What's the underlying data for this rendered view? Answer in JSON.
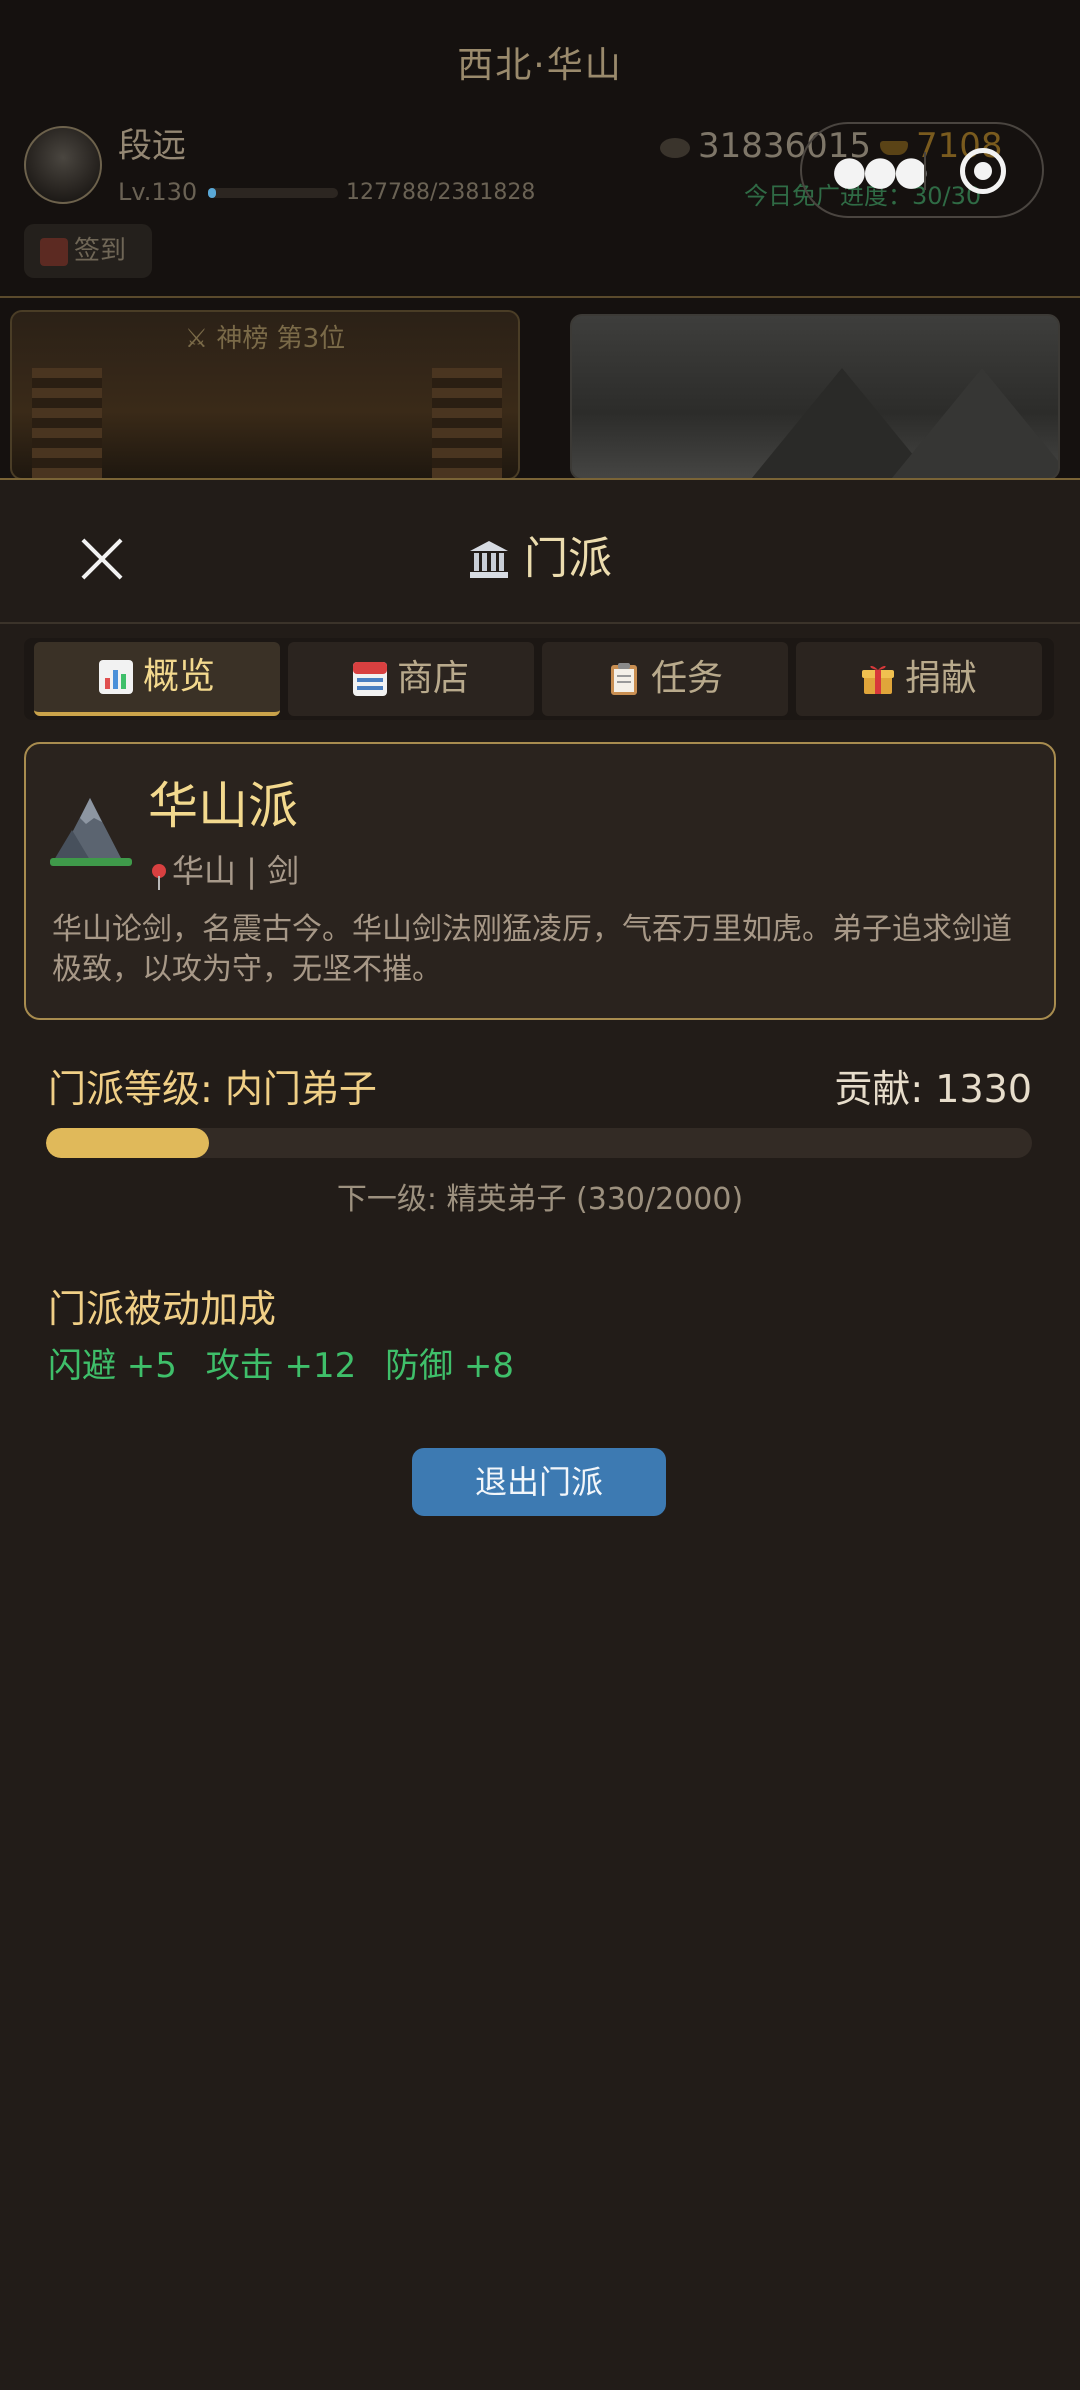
{
  "background": {
    "region_title": "西北·华山",
    "player": {
      "name": "段远",
      "level": "Lv.130",
      "xp": "127788/2381828"
    },
    "currency": {
      "coins": "31836015",
      "ingots": "7108"
    },
    "ad_progress": "今日免广进度：30/30",
    "signin_label": "签到",
    "rank_label": "⚔ 神榜 第3位"
  },
  "panel": {
    "title": "门派",
    "tabs": [
      {
        "label": "概览",
        "icon": "chart-icon"
      },
      {
        "label": "商店",
        "icon": "calendar-icon"
      },
      {
        "label": "任务",
        "icon": "clipboard-icon"
      },
      {
        "label": "捐献",
        "icon": "gift-icon"
      }
    ],
    "sect": {
      "name": "华山派",
      "location": "华山 | 剑",
      "description": "华山论剑，名震古今。华山剑法刚猛凌厉，气吞万里如虎。弟子追求剑道极致，以攻为守，无坚不摧。"
    },
    "rank": {
      "label": "门派等级: 内门弟子",
      "contribution": "贡献: 1330",
      "progress": 0.165,
      "next_level": "下一级: 精英弟子 (330/2000)"
    },
    "bonus": {
      "title": "门派被动加成",
      "items": [
        "闪避 +5",
        "攻击 +12",
        "防御 +8"
      ]
    },
    "quit_button": "退出门派"
  },
  "colors": {
    "accent_gold": "#f3d98e",
    "bonus_green": "#3fbf6a",
    "quit_blue": "#3d7ab2"
  }
}
